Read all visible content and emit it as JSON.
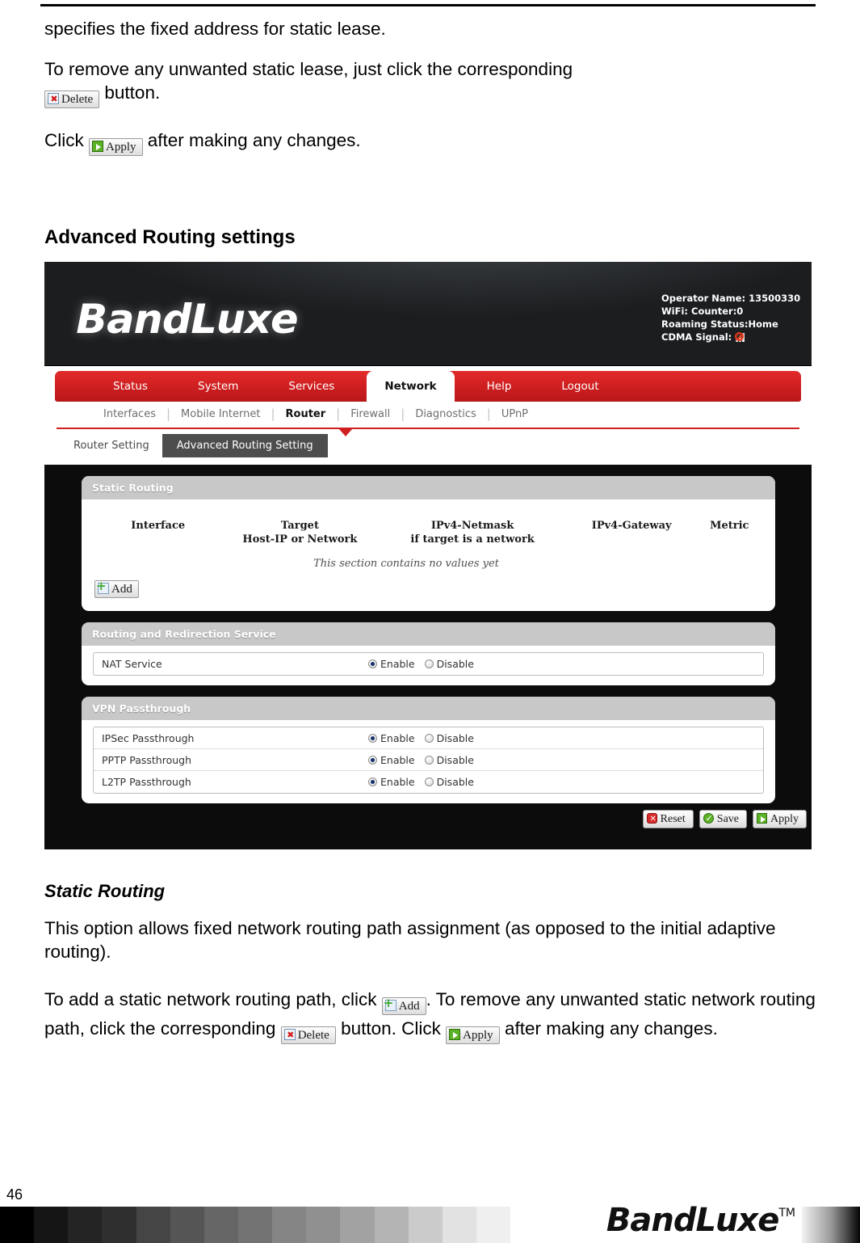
{
  "doc": {
    "para1": "specifies the fixed address for static lease.",
    "para2_before": "To remove any unwanted static lease, just click the corresponding",
    "para2_after": "button.",
    "para3_before": "Click",
    "para3_after": "after making any changes.",
    "section_heading": "Advanced Routing settings",
    "sub_heading": "Static Routing",
    "para4": "This option allows fixed network routing path assignment (as opposed to the initial adaptive routing).",
    "para5_a": "To add a static network routing path, click",
    "para5_b": ". To remove any unwanted static network routing path, click the corresponding",
    "para5_c": "button. Click",
    "para5_d": "after making any changes.",
    "delete_label": "Delete",
    "apply_label": "Apply",
    "add_label": "Add"
  },
  "router_ui": {
    "brand": "BandLuxe",
    "status": {
      "operator": "Operator Name: 13500330",
      "wifi": "WiFi: Counter:0",
      "roaming": "Roaming Status:Home",
      "cdma_label": "CDMA Signal:"
    },
    "main_nav": [
      {
        "label": "Status",
        "active": false
      },
      {
        "label": "System",
        "active": false
      },
      {
        "label": "Services",
        "active": false
      },
      {
        "label": "Network",
        "active": true
      },
      {
        "label": "Help",
        "active": false
      },
      {
        "label": "Logout",
        "active": false
      }
    ],
    "sub_nav": [
      {
        "label": "Interfaces",
        "active": false
      },
      {
        "label": "Mobile Internet",
        "active": false
      },
      {
        "label": "Router",
        "active": true
      },
      {
        "label": "Firewall",
        "active": false
      },
      {
        "label": "Diagnostics",
        "active": false
      },
      {
        "label": "UPnP",
        "active": false
      }
    ],
    "tabs": [
      {
        "label": "Router Setting",
        "active": false
      },
      {
        "label": "Advanced Routing Setting",
        "active": true
      }
    ],
    "static_routing": {
      "title": "Static Routing",
      "columns": [
        {
          "line1": "Interface",
          "line2": ""
        },
        {
          "line1": "Target",
          "line2": "Host-IP or Network"
        },
        {
          "line1": "IPv4-Netmask",
          "line2": "if target is a network"
        },
        {
          "line1": "IPv4-Gateway",
          "line2": ""
        },
        {
          "line1": "Metric",
          "line2": ""
        }
      ],
      "empty_message": "This section contains no values yet",
      "add_label": "Add"
    },
    "routing_service": {
      "title": "Routing and Redirection Service",
      "rows": [
        {
          "label": "NAT Service",
          "enable_label": "Enable",
          "disable_label": "Disable",
          "selected": "Enable"
        }
      ]
    },
    "vpn_passthrough": {
      "title": "VPN Passthrough",
      "rows": [
        {
          "label": "IPSec Passthrough",
          "enable_label": "Enable",
          "disable_label": "Disable",
          "selected": "Enable"
        },
        {
          "label": "PPTP Passthrough",
          "enable_label": "Enable",
          "disable_label": "Disable",
          "selected": "Enable"
        },
        {
          "label": "L2TP Passthrough",
          "enable_label": "Enable",
          "disable_label": "Disable",
          "selected": "Enable"
        }
      ]
    },
    "actions": [
      {
        "label": "Reset",
        "icon": "reset"
      },
      {
        "label": "Save",
        "icon": "save"
      },
      {
        "label": "Apply",
        "icon": "apply"
      }
    ]
  },
  "footer": {
    "page_number": "46",
    "logo": "BandLuxe",
    "tm": "TM",
    "grayscale_steps": [
      "#000000",
      "#151515",
      "#242424",
      "#2f2f2f",
      "#454545",
      "#555555",
      "#666666",
      "#737373",
      "#858585",
      "#909090",
      "#a2a2a2",
      "#b4b4b4",
      "#cbcbcb",
      "#e2e2e2",
      "#efefef"
    ]
  }
}
